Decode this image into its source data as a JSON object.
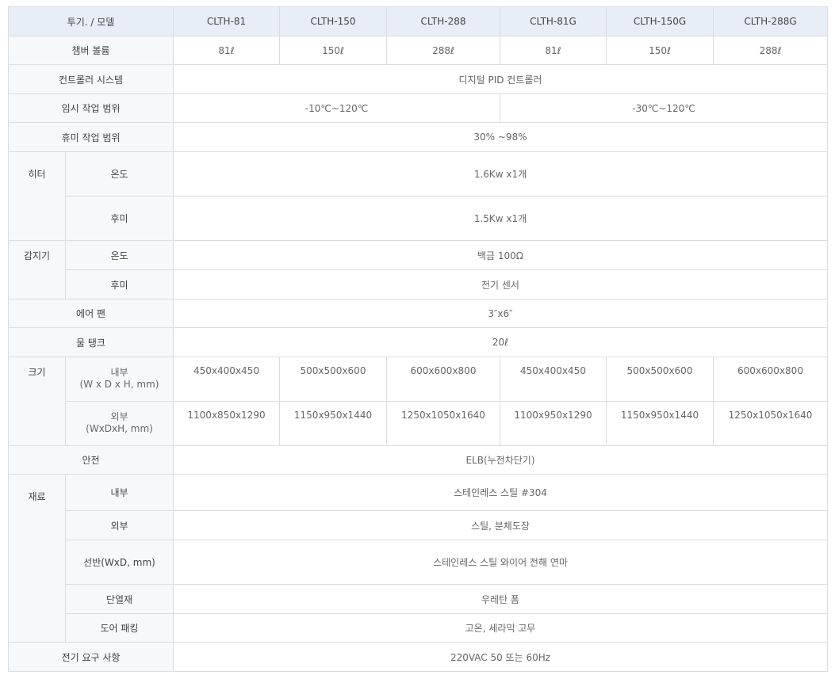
{
  "header": {
    "label": "투기. / 모델",
    "models": [
      "CLTH-81",
      "CLTH-150",
      "CLTH-288",
      "CLTH-81G",
      "CLTH-150G",
      "CLTH-288G"
    ]
  },
  "rows": {
    "chamber": {
      "label": "챔버 볼륨",
      "values": [
        "81ℓ",
        "150ℓ",
        "288ℓ",
        "81ℓ",
        "150ℓ",
        "288ℓ"
      ]
    },
    "controller": {
      "label": "컨트롤러 시스템",
      "value": "디지털 PID 컨트롤러"
    },
    "temp_range": {
      "label": "임시 작업 범위",
      "values": [
        "-10℃~120℃",
        "-30℃~120℃"
      ]
    },
    "humid_range": {
      "label": "휴미 작업 범위",
      "value": "30% ~98%"
    },
    "heater": {
      "group": "히터",
      "temp_label": "온도",
      "temp_value": "1.6Kw x1개",
      "humid_label": "후미",
      "humid_value": "1.5Kw x1개"
    },
    "sensor": {
      "group": "감지기",
      "temp_label": "온도",
      "temp_value": "백금 100Ω",
      "humid_label": "후미",
      "humid_value": "전기 센서"
    },
    "fan": {
      "label": "에어 팬",
      "value": "3″x6″"
    },
    "water": {
      "label": "물 탱크",
      "value": "20ℓ"
    },
    "size": {
      "group": "크기",
      "inner_label": "내부",
      "inner_unit": "(W x D x H, mm)",
      "inner_values": [
        "450x400x450",
        "500x500x600",
        "600x600x800",
        "450x400x450",
        "500x500x600",
        "600x600x800"
      ],
      "outer_label": "외부",
      "outer_unit": "(WxDxH, mm)",
      "outer_values": [
        "1100x850x1290",
        "1150x950x1440",
        "1250x1050x1640",
        "1100x950x1290",
        "1150x950x1440",
        "1250x1050x1640"
      ]
    },
    "safety": {
      "label": "안전",
      "value": "ELB(누전차단기)"
    },
    "material": {
      "group": "재료",
      "inner_label": "내부",
      "inner_value": "스테인레스 스틸 #304",
      "outer_label": "외부",
      "outer_value": "스틸, 분체도장",
      "shelf_label": "선반(WxD, mm)",
      "shelf_value": "스테인레스 스틸 와이어 전해 연마",
      "insul_label": "단열재",
      "insul_value": "우레탄 폼",
      "door_label": "도어 패킹",
      "door_value": "고온, 세라믹 고무"
    },
    "power": {
      "label": "전기 요구 사항",
      "value": "220VAC 50 또는 60Hz"
    }
  }
}
